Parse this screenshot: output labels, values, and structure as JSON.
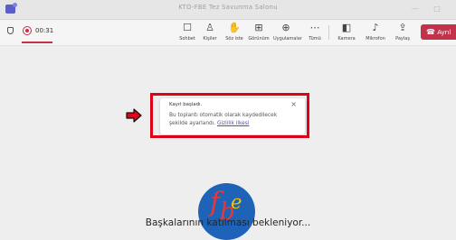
{
  "window": {
    "title": "KTO-FBE Tez Savunma Salonu",
    "controls": [
      "—",
      "□"
    ]
  },
  "meeting": {
    "recording_timer": "00:31",
    "recording_color": "#c4314b"
  },
  "toolbar": {
    "buttons": [
      {
        "label": "Sohbet",
        "icon": "chat-icon",
        "glyph": "☐"
      },
      {
        "label": "Kişiler",
        "icon": "people-icon",
        "glyph": "♙"
      },
      {
        "label": "Söz iste",
        "icon": "raise-hand-icon",
        "glyph": "✋"
      },
      {
        "label": "Görünüm",
        "icon": "view-icon",
        "glyph": "⊞"
      },
      {
        "label": "Uygulamalar",
        "icon": "apps-icon",
        "glyph": "⊕"
      },
      {
        "label": "Tümü",
        "icon": "more-icon",
        "glyph": "⋯"
      },
      {
        "label": "Kamera",
        "icon": "camera-off-icon",
        "glyph": "◧"
      },
      {
        "label": "Mikrofon",
        "icon": "mic-off-icon",
        "glyph": "♪"
      },
      {
        "label": "Paylaş",
        "icon": "share-icon",
        "glyph": "⇪"
      }
    ],
    "leave_label": "Ayrıl",
    "leave_color": "#c4314b"
  },
  "notification": {
    "title": "Kayıt başladı.",
    "body": "Bu toplantı otomatik olarak kaydedilecek şekilde ayarlandı.",
    "link": "Gizlilik ilkesi",
    "highlight_color": "#e1001a"
  },
  "logo": {
    "letters": [
      "f",
      "b",
      "e"
    ],
    "background_color": "#1f63b8"
  },
  "status_message": "Başkalarının katılması bekleniyor..."
}
